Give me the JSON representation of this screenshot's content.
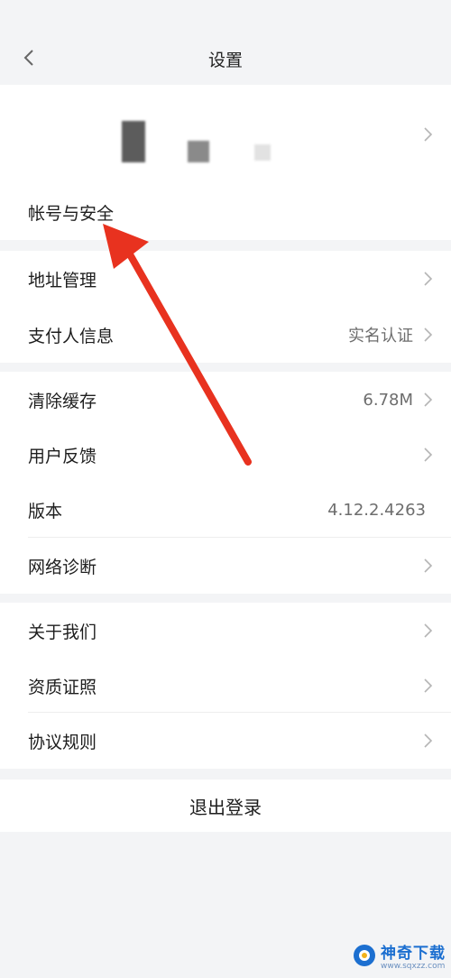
{
  "header": {
    "title": "设置"
  },
  "account": {
    "label": "帐号与安全"
  },
  "group1": [
    {
      "label": "地址管理",
      "value": ""
    },
    {
      "label": "支付人信息",
      "value": "实名认证"
    }
  ],
  "group2": [
    {
      "label": "清除缓存",
      "value": "6.78M"
    },
    {
      "label": "用户反馈",
      "value": ""
    },
    {
      "label": "版本",
      "value": "4.12.2.4263"
    },
    {
      "label": "网络诊断",
      "value": ""
    }
  ],
  "group3": [
    {
      "label": "关于我们"
    },
    {
      "label": "资质证照"
    },
    {
      "label": "协议规则"
    }
  ],
  "logout": {
    "label": "退出登录"
  },
  "watermark": {
    "brand": "神奇下载",
    "site": "www.sqxzz.com"
  },
  "colors": {
    "annotation": "#e8321f",
    "background": "#f3f4f6"
  },
  "icons": {
    "back": "chevron-left-icon",
    "row_arrow": "chevron-right-icon"
  }
}
